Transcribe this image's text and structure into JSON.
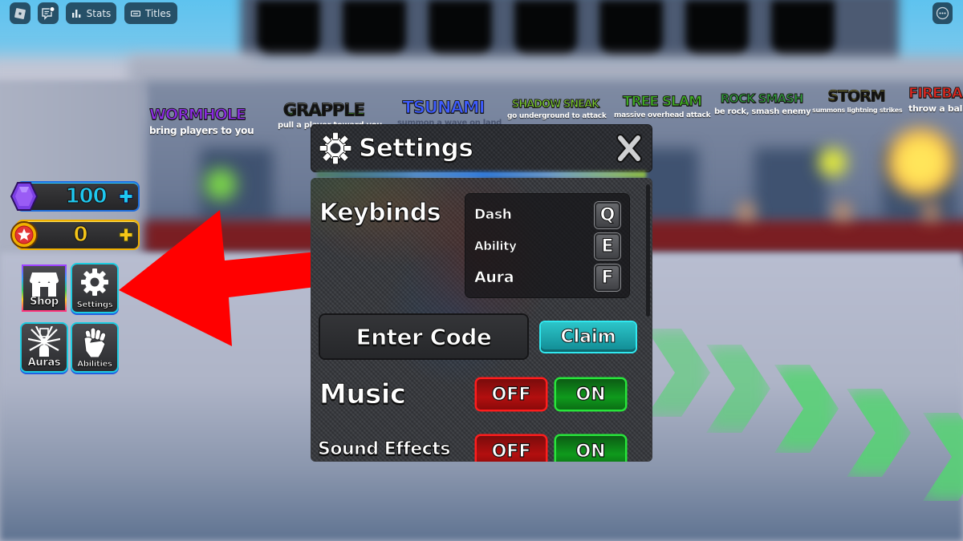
{
  "top_bar": {
    "roblox_menu": {
      "icon": "roblox-logo-icon"
    },
    "chat": {
      "icon": "chat-icon",
      "has_notification": true
    },
    "stats": {
      "label": "Stats",
      "icon": "bar-chart-icon"
    },
    "titles": {
      "label": "Titles",
      "icon": "title-card-icon"
    },
    "more": {
      "icon": "more-options-icon"
    }
  },
  "abilities_banners": [
    {
      "name": "WORMHOLE",
      "desc": "bring players to you",
      "color": "#8a2be2"
    },
    {
      "name": "GRAPPLE",
      "desc": "pull a player toward you",
      "color": "#9aa59a"
    },
    {
      "name": "TSUNAMI",
      "desc": "summon a wave on land",
      "color": "#3d5cff"
    },
    {
      "name": "SHADOW SNEAK",
      "desc": "go underground to attack",
      "color": "#7ccf2e"
    },
    {
      "name": "TREE SLAM",
      "desc": "massive overhead attack",
      "color": "#3fae22"
    },
    {
      "name": "ROCK SMASH",
      "desc": "be rock, smash enemy",
      "color": "#2f9a3a"
    },
    {
      "name": "STORM",
      "desc": "summons lightning strikes",
      "color": "#e6e03a"
    },
    {
      "name": "FIREBA",
      "desc": "throw a ball o",
      "color": "#e0261e"
    }
  ],
  "currency": {
    "gems": {
      "value": "100",
      "icon": "gem-icon",
      "accent": "#1ec8f0"
    },
    "coins": {
      "value": "0",
      "icon": "star-coin-icon",
      "accent": "#f5c518"
    }
  },
  "menu_buttons": [
    {
      "label": "Shop",
      "icon": "shop-icon"
    },
    {
      "label": "Settings",
      "icon": "gear-icon"
    },
    {
      "label": "Auras",
      "icon": "aura-icon"
    },
    {
      "label": "Abilities",
      "icon": "fist-icon"
    }
  ],
  "annotation": {
    "type": "red-arrow",
    "points_to": "Settings"
  },
  "settings": {
    "title": "Settings",
    "close_icon": "close-icon",
    "keybinds": {
      "label": "Keybinds",
      "rows": [
        {
          "action": "Dash",
          "key": "Q"
        },
        {
          "action": "Ability",
          "key": "E"
        },
        {
          "action": "Aura",
          "key": "F"
        }
      ]
    },
    "code": {
      "placeholder": "Enter Code",
      "claim_label": "Claim"
    },
    "music": {
      "label": "Music",
      "off_label": "OFF",
      "on_label": "ON"
    },
    "sound_effects": {
      "label": "Sound Effects",
      "off_label": "OFF",
      "on_label": "ON"
    }
  }
}
